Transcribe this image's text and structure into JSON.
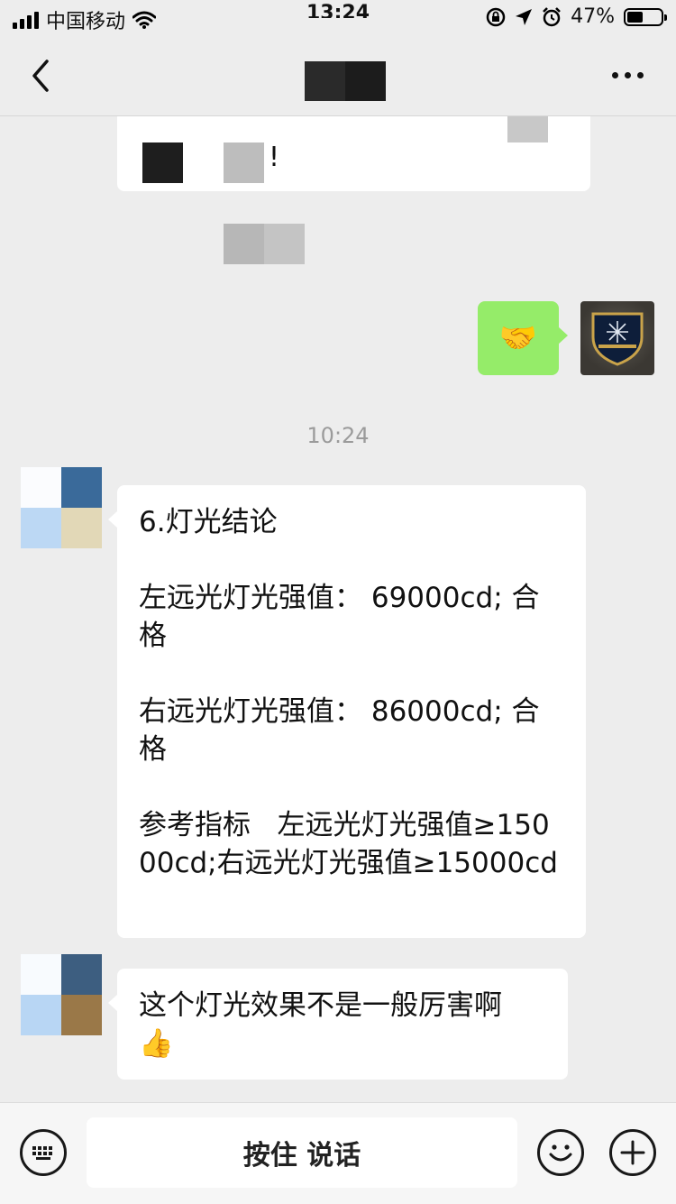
{
  "status_bar": {
    "carrier": "中国移动",
    "time": "13:24",
    "battery_percent": "47%",
    "battery_level": 0.47,
    "icons": [
      "signal-icon",
      "wifi-icon",
      "rotation-lock-icon",
      "location-arrow-icon",
      "alarm-icon",
      "battery-icon"
    ]
  },
  "nav": {
    "back_icon": "chevron-left-icon",
    "more_icon": "more-dots-icon"
  },
  "messages": {
    "blurred_text_suffix": "!",
    "sent_emoji": "🤝",
    "time_divider": "10:24",
    "conclusion_text": "6.灯光结论\n\n左远光灯光强值： 69000cd; 合格\n\n右远光灯光强值： 86000cd; 合格\n\n参考指标   左远光灯光强值≥15000cd;右远光灯光强值≥15000cd",
    "comment_text": "这个灯光效果不是一般厉害啊",
    "comment_emoji": "👍"
  },
  "input_bar": {
    "hold_to_talk": "按住 说话",
    "icons": [
      "keyboard-icon",
      "emoji-face-icon",
      "plus-circle-icon"
    ]
  },
  "colors": {
    "background": "#ededed",
    "sent_bubble": "#95ec69",
    "received_bubble": "#ffffff"
  }
}
